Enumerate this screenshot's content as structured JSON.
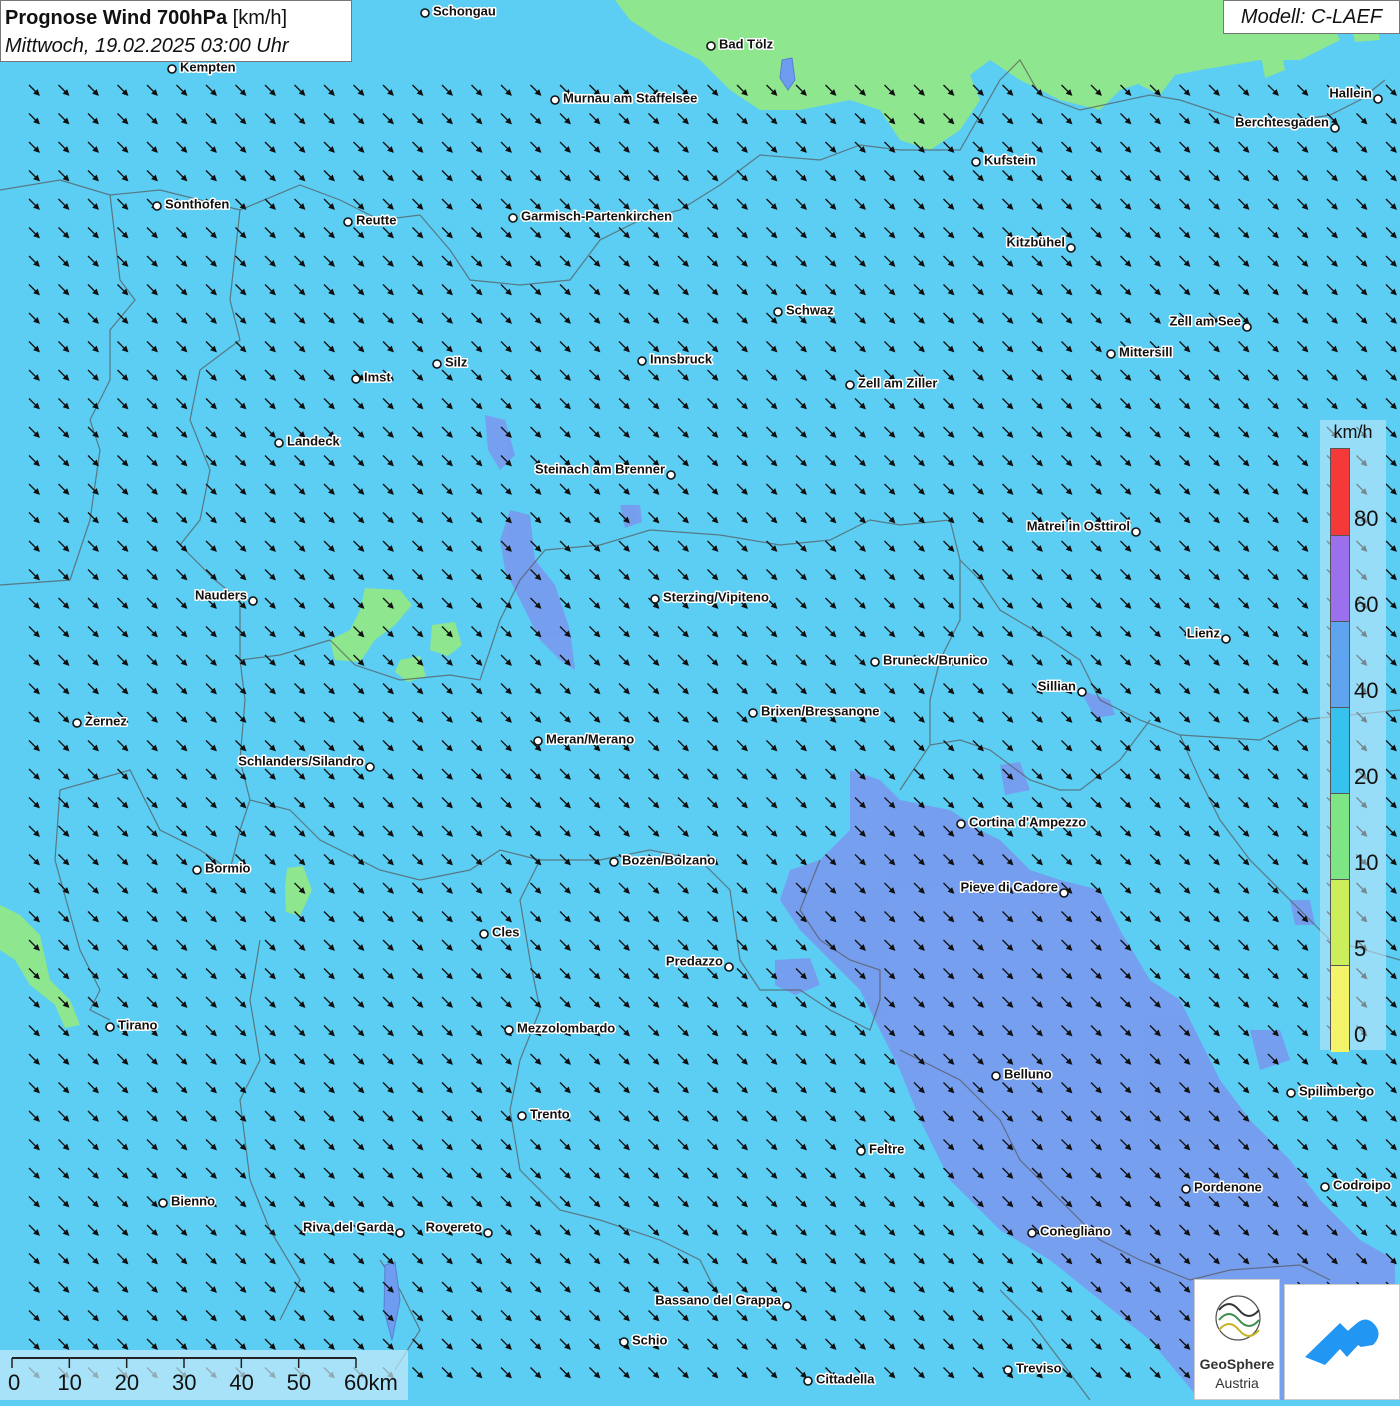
{
  "title": {
    "bold": "Prognose Wind 700hPa",
    "unit": " [km/h]",
    "date": "Mittwoch, 19.02.2025 03:00 Uhr"
  },
  "model": "Modell: C-LAEF",
  "legend": {
    "unit": "km/h",
    "labels": [
      "80",
      "60",
      "40",
      "20",
      "10",
      "5",
      "0"
    ],
    "colors": [
      "#f53838",
      "#9b70ec",
      "#5ea4ee",
      "#36c2ec",
      "#7ee585",
      "#ccee5a",
      "#f4f46a"
    ]
  },
  "scalebar": {
    "labels": [
      "0",
      "10",
      "20",
      "30",
      "40",
      "50",
      "60km"
    ]
  },
  "logos": {
    "geosphere_line1": "GeoSphere",
    "geosphere_line2": "Austria"
  },
  "cities": [
    {
      "name": "Schongau"
    },
    {
      "name": "Bad Tölz"
    },
    {
      "name": "Kempten"
    },
    {
      "name": "Murnau am Staffelsee"
    },
    {
      "name": "Hallein"
    },
    {
      "name": "Berchtesgaden"
    },
    {
      "name": "Kufstein"
    },
    {
      "name": "Sonthofen"
    },
    {
      "name": "Reutte"
    },
    {
      "name": "Garmisch-Partenkirchen"
    },
    {
      "name": "Kitzbühel"
    },
    {
      "name": "Schwaz"
    },
    {
      "name": "Zell am See"
    },
    {
      "name": "Mittersill"
    },
    {
      "name": "Innsbruck"
    },
    {
      "name": "Silz"
    },
    {
      "name": "Imst"
    },
    {
      "name": "Zell am Ziller"
    },
    {
      "name": "Landeck"
    },
    {
      "name": "Steinach am Brenner"
    },
    {
      "name": "Matrei in Osttirol"
    },
    {
      "name": "Nauders"
    },
    {
      "name": "Sterzing/Vipiteno"
    },
    {
      "name": "Lienz"
    },
    {
      "name": "Bruneck/Brunico"
    },
    {
      "name": "Sillian"
    },
    {
      "name": "Brixen/Bressanone"
    },
    {
      "name": "Zernez"
    },
    {
      "name": "Meran/Merano"
    },
    {
      "name": "Schlanders/Silandro"
    },
    {
      "name": "Cortina d'Ampezzo"
    },
    {
      "name": "Bormio"
    },
    {
      "name": "Bozen/Bolzano"
    },
    {
      "name": "Pieve di Cadore"
    },
    {
      "name": "Cles"
    },
    {
      "name": "Predazzo"
    },
    {
      "name": "Tirano"
    },
    {
      "name": "Mezzolombardo"
    },
    {
      "name": "Belluno"
    },
    {
      "name": "Spilimbergo"
    },
    {
      "name": "Trento"
    },
    {
      "name": "Feltre"
    },
    {
      "name": "Pordenone"
    },
    {
      "name": "Codroipo"
    },
    {
      "name": "Bienno"
    },
    {
      "name": "Riva del Garda"
    },
    {
      "name": "Rovereto"
    },
    {
      "name": "Conegliano"
    },
    {
      "name": "Bassano del Grappa"
    },
    {
      "name": "Schio"
    },
    {
      "name": "Treviso"
    },
    {
      "name": "Cittadella"
    }
  ]
}
